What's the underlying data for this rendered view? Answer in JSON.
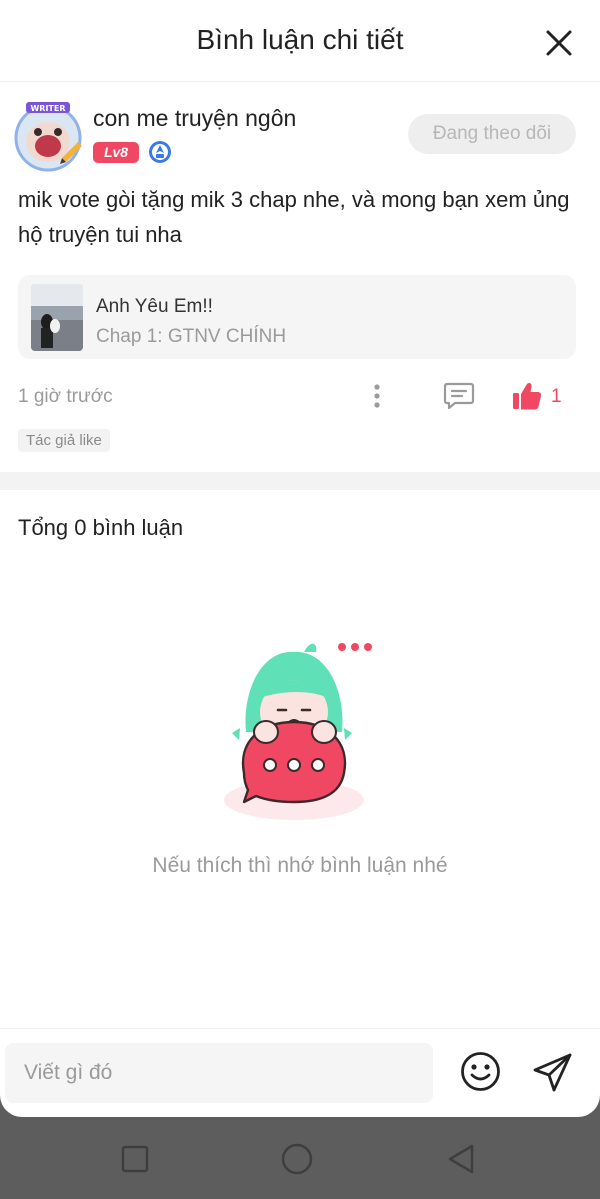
{
  "header": {
    "title": "Bình luận chi tiết"
  },
  "comment": {
    "username": "con me truyện ngôn",
    "level": "Lv8",
    "follow_label": "Đang theo dõi",
    "text": "mik vote gòi tặng mik 3 chap nhe, và mong bạn xem ủng hộ truyện tui nha",
    "story": {
      "title": "Anh Yêu Em!!",
      "chapter": "Chap 1: GTNV CHÍNH"
    },
    "time": "1 giờ trước",
    "like_count": "1",
    "author_tag": "Tác giả like"
  },
  "comments_section": {
    "total_label": "Tổng 0 bình luận",
    "empty_message": "Nếu thích thì nhớ bình luận nhé"
  },
  "input": {
    "placeholder": "Viết gì đó"
  },
  "colors": {
    "accent": "#f04763",
    "mascot_hair": "#5fe0b7",
    "muted": "#9a9a9a"
  },
  "icons": [
    "close-icon",
    "verified-icon",
    "more-icon",
    "reply-icon",
    "thumbs-up-icon",
    "emoji-icon",
    "send-icon",
    "nav-square-icon",
    "nav-home-icon",
    "nav-back-icon"
  ]
}
